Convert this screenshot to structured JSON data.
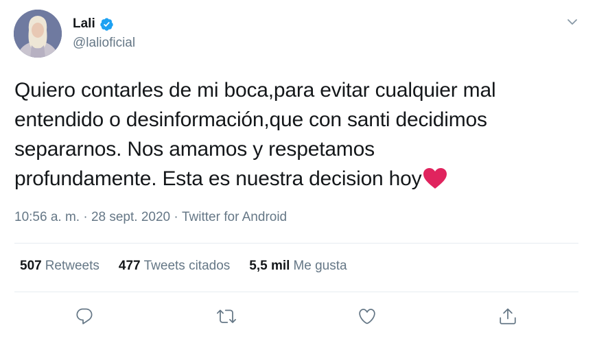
{
  "author": {
    "display_name": "Lali",
    "handle": "@lalioficial",
    "verified": true
  },
  "tweet": {
    "text_line1": "Quiero contarles de mi boca,para evitar cualquier mal",
    "text_line2": "entendido o desinformación,que con santi decidimos",
    "text_line3": "separarnos. Nos amamos y respetamos",
    "text_line4": "profundamente. Esta es nuestra decision hoy",
    "emoji": "red-heart"
  },
  "meta": {
    "time": "10:56 a. m.",
    "separator": " · ",
    "date": "28 sept. 2020",
    "source": "Twitter for Android"
  },
  "stats": {
    "retweets": {
      "count": "507",
      "label": "Retweets"
    },
    "quotes": {
      "count": "477",
      "label": "Tweets citados"
    },
    "likes": {
      "count": "5,5 mil",
      "label": "Me gusta"
    }
  },
  "actions": {
    "reply_icon": "reply-icon",
    "retweet_icon": "retweet-icon",
    "like_icon": "like-icon",
    "share_icon": "share-icon"
  },
  "colors": {
    "primary_text": "#14171a",
    "secondary_text": "#657786",
    "verified_blue": "#1da1f2",
    "divider": "#e6ecf0",
    "heart_red": "#e0245e"
  }
}
